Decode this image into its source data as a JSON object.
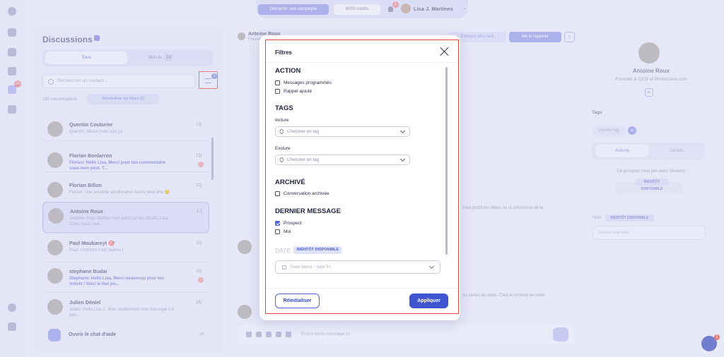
{
  "topbar": {
    "campaign_button": "Démarrer une campagne",
    "credits": "6000 credits",
    "notif_count": "1",
    "user_name": "Lisa J. Martinez"
  },
  "rail": {
    "badge": "24"
  },
  "discussions": {
    "title": "Discussions",
    "tabs": [
      {
        "label": "Tous"
      },
      {
        "label": "Non lu",
        "count": "18"
      }
    ],
    "search_placeholder": "Rechercher un contact...",
    "filter_count": "1",
    "conversation_count": "180 conversations",
    "reset_filters": "Réinitialiser les filtres (1)",
    "conversations": [
      {
        "name": "Quentin Couturier",
        "preview": "Quentin: Nickel j'vais voir ça",
        "time": "13j",
        "highlight": false,
        "alert": false,
        "selected": false
      },
      {
        "name": "Florian Bonlarron",
        "preview": "Florian: Hello Lisa, Merci pour ton commentaire sous mon post. T...",
        "time": "13j",
        "highlight": true,
        "alert": true,
        "selected": false
      },
      {
        "name": "Florian Billon",
        "preview": "Florian: Une possible amélioration future peut être 😊",
        "time": "13j",
        "highlight": false,
        "alert": false,
        "selected": false
      },
      {
        "name": "Antoine Roux",
        "preview": "Antoine: Pour illustrer mon point sur les détails, Lisa : Chez nous, une...",
        "time": "17j",
        "highlight": false,
        "alert": false,
        "selected": true
      },
      {
        "name": "Paul Maubareyt 🎯",
        "preview": "Paul: c'est bon c'est revenu !",
        "time": "21j",
        "highlight": false,
        "alert": false,
        "selected": false
      },
      {
        "name": "stephane Budai",
        "preview": "Stephane: Hello Lisa, Merci beaucoup pour ton intérêt ! Voici le lien po...",
        "time": "21j",
        "highlight": true,
        "alert": true,
        "selected": false
      },
      {
        "name": "Julien Déniel",
        "preview": "Julien: Hello Lisa J., Bon, visiblement mon message n'a pas...",
        "time": "24j",
        "highlight": false,
        "alert": false,
        "selected": false
      }
    ],
    "help_chat": "Ouvrir le chat d'aide"
  },
  "conversation": {
    "contact_name": "Antoine Roux",
    "contact_role": "Founder",
    "send_later": "Envoyer plus tard",
    "remind": "Me le rappeler",
    "msg1": "c'est plutôt les délais ou la cohérence de la",
    "msg2": "ou cartes de visite. C'est le concret de notre",
    "compose_placeholder": "Écrire votre message ici"
  },
  "profile": {
    "name": "Antoine Roux",
    "role": "Founder & CEO of Printoclock.com",
    "linkedin": "in",
    "tags_title": "Tags",
    "add_tag": "Ajouter tag",
    "tabs": [
      "Activity",
      "Détails"
    ],
    "not_in_app": "Ce prospect n'est pas dans Waalaxy",
    "soon": "BIENTÔT DISPONIBLE",
    "note_label": "Note",
    "note_placeholder": "Ajouter une note"
  },
  "chat_badge": "3",
  "filters": {
    "title": "Filtres",
    "action": {
      "title": "ACTION",
      "options": [
        {
          "label": "Messages programmés",
          "checked": false
        },
        {
          "label": "Rappel ajouté",
          "checked": false
        }
      ]
    },
    "tags": {
      "title": "TAGS",
      "include_label": "Inclure",
      "exclude_label": "Exclure",
      "placeholder": "Chercher un tag"
    },
    "archived": {
      "title": "ARCHIVÉ",
      "options": [
        {
          "label": "Conversation archivée",
          "checked": false
        }
      ]
    },
    "last_message": {
      "title": "DERNIER MESSAGE",
      "options": [
        {
          "label": "Prospect",
          "checked": true
        },
        {
          "label": "Moi",
          "checked": false
        }
      ]
    },
    "date": {
      "title": "DATE",
      "soon": "BIENTÔT DISPONIBLE",
      "placeholder": "Date début - date fin"
    },
    "reset_button": "Réinitialiser",
    "apply_button": "Appliquer"
  }
}
